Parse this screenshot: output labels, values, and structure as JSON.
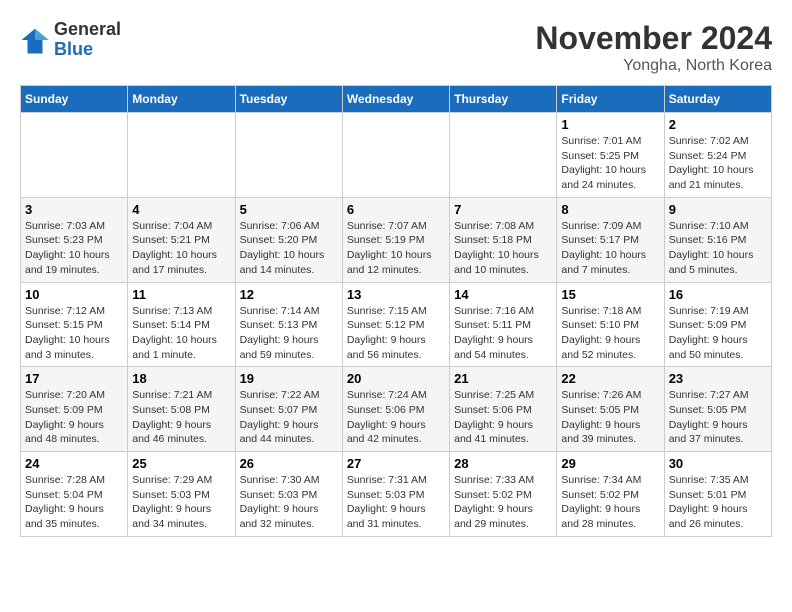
{
  "logo": {
    "general": "General",
    "blue": "Blue"
  },
  "header": {
    "month": "November 2024",
    "location": "Yongha, North Korea"
  },
  "days_of_week": [
    "Sunday",
    "Monday",
    "Tuesday",
    "Wednesday",
    "Thursday",
    "Friday",
    "Saturday"
  ],
  "weeks": [
    [
      {
        "day": "",
        "info": ""
      },
      {
        "day": "",
        "info": ""
      },
      {
        "day": "",
        "info": ""
      },
      {
        "day": "",
        "info": ""
      },
      {
        "day": "",
        "info": ""
      },
      {
        "day": "1",
        "info": "Sunrise: 7:01 AM\nSunset: 5:25 PM\nDaylight: 10 hours and 24 minutes."
      },
      {
        "day": "2",
        "info": "Sunrise: 7:02 AM\nSunset: 5:24 PM\nDaylight: 10 hours and 21 minutes."
      }
    ],
    [
      {
        "day": "3",
        "info": "Sunrise: 7:03 AM\nSunset: 5:23 PM\nDaylight: 10 hours and 19 minutes."
      },
      {
        "day": "4",
        "info": "Sunrise: 7:04 AM\nSunset: 5:21 PM\nDaylight: 10 hours and 17 minutes."
      },
      {
        "day": "5",
        "info": "Sunrise: 7:06 AM\nSunset: 5:20 PM\nDaylight: 10 hours and 14 minutes."
      },
      {
        "day": "6",
        "info": "Sunrise: 7:07 AM\nSunset: 5:19 PM\nDaylight: 10 hours and 12 minutes."
      },
      {
        "day": "7",
        "info": "Sunrise: 7:08 AM\nSunset: 5:18 PM\nDaylight: 10 hours and 10 minutes."
      },
      {
        "day": "8",
        "info": "Sunrise: 7:09 AM\nSunset: 5:17 PM\nDaylight: 10 hours and 7 minutes."
      },
      {
        "day": "9",
        "info": "Sunrise: 7:10 AM\nSunset: 5:16 PM\nDaylight: 10 hours and 5 minutes."
      }
    ],
    [
      {
        "day": "10",
        "info": "Sunrise: 7:12 AM\nSunset: 5:15 PM\nDaylight: 10 hours and 3 minutes."
      },
      {
        "day": "11",
        "info": "Sunrise: 7:13 AM\nSunset: 5:14 PM\nDaylight: 10 hours and 1 minute."
      },
      {
        "day": "12",
        "info": "Sunrise: 7:14 AM\nSunset: 5:13 PM\nDaylight: 9 hours and 59 minutes."
      },
      {
        "day": "13",
        "info": "Sunrise: 7:15 AM\nSunset: 5:12 PM\nDaylight: 9 hours and 56 minutes."
      },
      {
        "day": "14",
        "info": "Sunrise: 7:16 AM\nSunset: 5:11 PM\nDaylight: 9 hours and 54 minutes."
      },
      {
        "day": "15",
        "info": "Sunrise: 7:18 AM\nSunset: 5:10 PM\nDaylight: 9 hours and 52 minutes."
      },
      {
        "day": "16",
        "info": "Sunrise: 7:19 AM\nSunset: 5:09 PM\nDaylight: 9 hours and 50 minutes."
      }
    ],
    [
      {
        "day": "17",
        "info": "Sunrise: 7:20 AM\nSunset: 5:09 PM\nDaylight: 9 hours and 48 minutes."
      },
      {
        "day": "18",
        "info": "Sunrise: 7:21 AM\nSunset: 5:08 PM\nDaylight: 9 hours and 46 minutes."
      },
      {
        "day": "19",
        "info": "Sunrise: 7:22 AM\nSunset: 5:07 PM\nDaylight: 9 hours and 44 minutes."
      },
      {
        "day": "20",
        "info": "Sunrise: 7:24 AM\nSunset: 5:06 PM\nDaylight: 9 hours and 42 minutes."
      },
      {
        "day": "21",
        "info": "Sunrise: 7:25 AM\nSunset: 5:06 PM\nDaylight: 9 hours and 41 minutes."
      },
      {
        "day": "22",
        "info": "Sunrise: 7:26 AM\nSunset: 5:05 PM\nDaylight: 9 hours and 39 minutes."
      },
      {
        "day": "23",
        "info": "Sunrise: 7:27 AM\nSunset: 5:05 PM\nDaylight: 9 hours and 37 minutes."
      }
    ],
    [
      {
        "day": "24",
        "info": "Sunrise: 7:28 AM\nSunset: 5:04 PM\nDaylight: 9 hours and 35 minutes."
      },
      {
        "day": "25",
        "info": "Sunrise: 7:29 AM\nSunset: 5:03 PM\nDaylight: 9 hours and 34 minutes."
      },
      {
        "day": "26",
        "info": "Sunrise: 7:30 AM\nSunset: 5:03 PM\nDaylight: 9 hours and 32 minutes."
      },
      {
        "day": "27",
        "info": "Sunrise: 7:31 AM\nSunset: 5:03 PM\nDaylight: 9 hours and 31 minutes."
      },
      {
        "day": "28",
        "info": "Sunrise: 7:33 AM\nSunset: 5:02 PM\nDaylight: 9 hours and 29 minutes."
      },
      {
        "day": "29",
        "info": "Sunrise: 7:34 AM\nSunset: 5:02 PM\nDaylight: 9 hours and 28 minutes."
      },
      {
        "day": "30",
        "info": "Sunrise: 7:35 AM\nSunset: 5:01 PM\nDaylight: 9 hours and 26 minutes."
      }
    ]
  ]
}
